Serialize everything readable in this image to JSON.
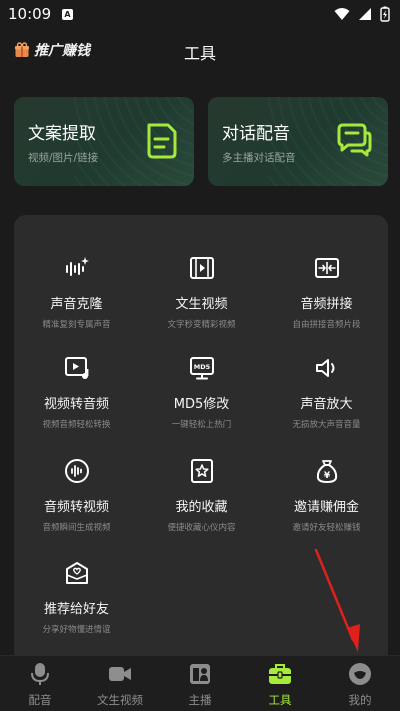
{
  "status_bar": {
    "time": "10:09",
    "notification_letter": "A"
  },
  "header": {
    "promo_label": "推广赚钱",
    "title": "工具"
  },
  "feature_cards": [
    {
      "title": "文案提取",
      "subtitle": "视频/图片/链接",
      "icon": "document-icon"
    },
    {
      "title": "对话配音",
      "subtitle": "多主播对话配音",
      "icon": "chat-bubbles-icon"
    }
  ],
  "tools": [
    {
      "name": "声音克隆",
      "desc": "精准复刻专属声音",
      "icon": "voice-wave-icon"
    },
    {
      "name": "文生视频",
      "desc": "文字秒变精彩视频",
      "icon": "film-play-icon"
    },
    {
      "name": "音频拼接",
      "desc": "自由拼接音频片段",
      "icon": "merge-icon"
    },
    {
      "name": "视频转音频",
      "desc": "视频音频轻松转换",
      "icon": "video-to-audio-icon"
    },
    {
      "name": "MD5修改",
      "desc": "一键轻松上热门",
      "icon": "md5-monitor-icon"
    },
    {
      "name": "声音放大",
      "desc": "无损放大声音音量",
      "icon": "speaker-icon"
    },
    {
      "name": "音频转视频",
      "desc": "音频瞬间生成视频",
      "icon": "audio-circle-icon"
    },
    {
      "name": "我的收藏",
      "desc": "便捷收藏心仪内容",
      "icon": "star-bookmark-icon"
    },
    {
      "name": "邀请赚佣金",
      "desc": "邀请好友轻松赚钱",
      "icon": "money-bag-icon"
    },
    {
      "name": "推荐给好友",
      "desc": "分享好物懂进情谊",
      "icon": "heart-envelope-icon"
    }
  ],
  "bottom_nav": [
    {
      "label": "配音",
      "icon": "microphone-icon",
      "active": false
    },
    {
      "label": "文生视频",
      "icon": "video-camera-icon",
      "active": false
    },
    {
      "label": "主播",
      "icon": "anchor-icon",
      "active": false
    },
    {
      "label": "工具",
      "icon": "toolbox-icon",
      "active": true
    },
    {
      "label": "我的",
      "icon": "profile-icon",
      "active": false
    }
  ],
  "colors": {
    "accent": "#a6ea3c",
    "card_green": "#1f3a2f",
    "panel": "#2c2c2c",
    "background": "#1b1b1b"
  }
}
